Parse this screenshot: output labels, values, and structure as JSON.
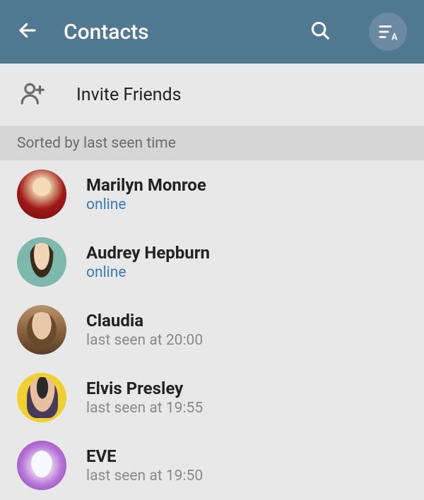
{
  "header": {
    "title": "Contacts"
  },
  "invite": {
    "label": "Invite Friends"
  },
  "sort": {
    "label": "Sorted by last seen time"
  },
  "contacts": [
    {
      "name": "Marilyn Monroe",
      "status": "online",
      "status_type": "online"
    },
    {
      "name": "Audrey Hepburn",
      "status": "online",
      "status_type": "online"
    },
    {
      "name": "Claudia",
      "status": "last seen at 20:00",
      "status_type": "offline"
    },
    {
      "name": "Elvis Presley",
      "status": "last seen at 19:55",
      "status_type": "offline"
    },
    {
      "name": "EVE",
      "status": "last seen at 19:50",
      "status_type": "offline"
    }
  ]
}
